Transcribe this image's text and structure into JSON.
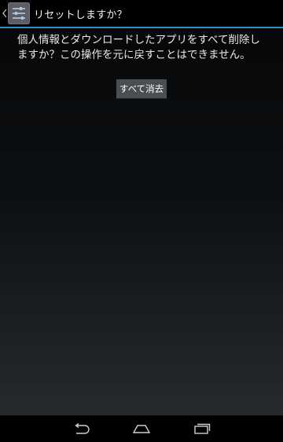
{
  "action_bar": {
    "title": "リセットしますか？",
    "accent_color": "#2f8fbf",
    "up_icon": "chevron-left-icon",
    "app_icon": "settings-sliders-icon"
  },
  "content": {
    "message": "個人情報とダウンロードしたアプリをすべて削除しますか？この操作を元に戻すことはできません。",
    "button_label": "すべて消去"
  },
  "nav_bar": {
    "back_icon": "back-icon",
    "home_icon": "home-icon",
    "recents_icon": "recent-apps-icon"
  }
}
